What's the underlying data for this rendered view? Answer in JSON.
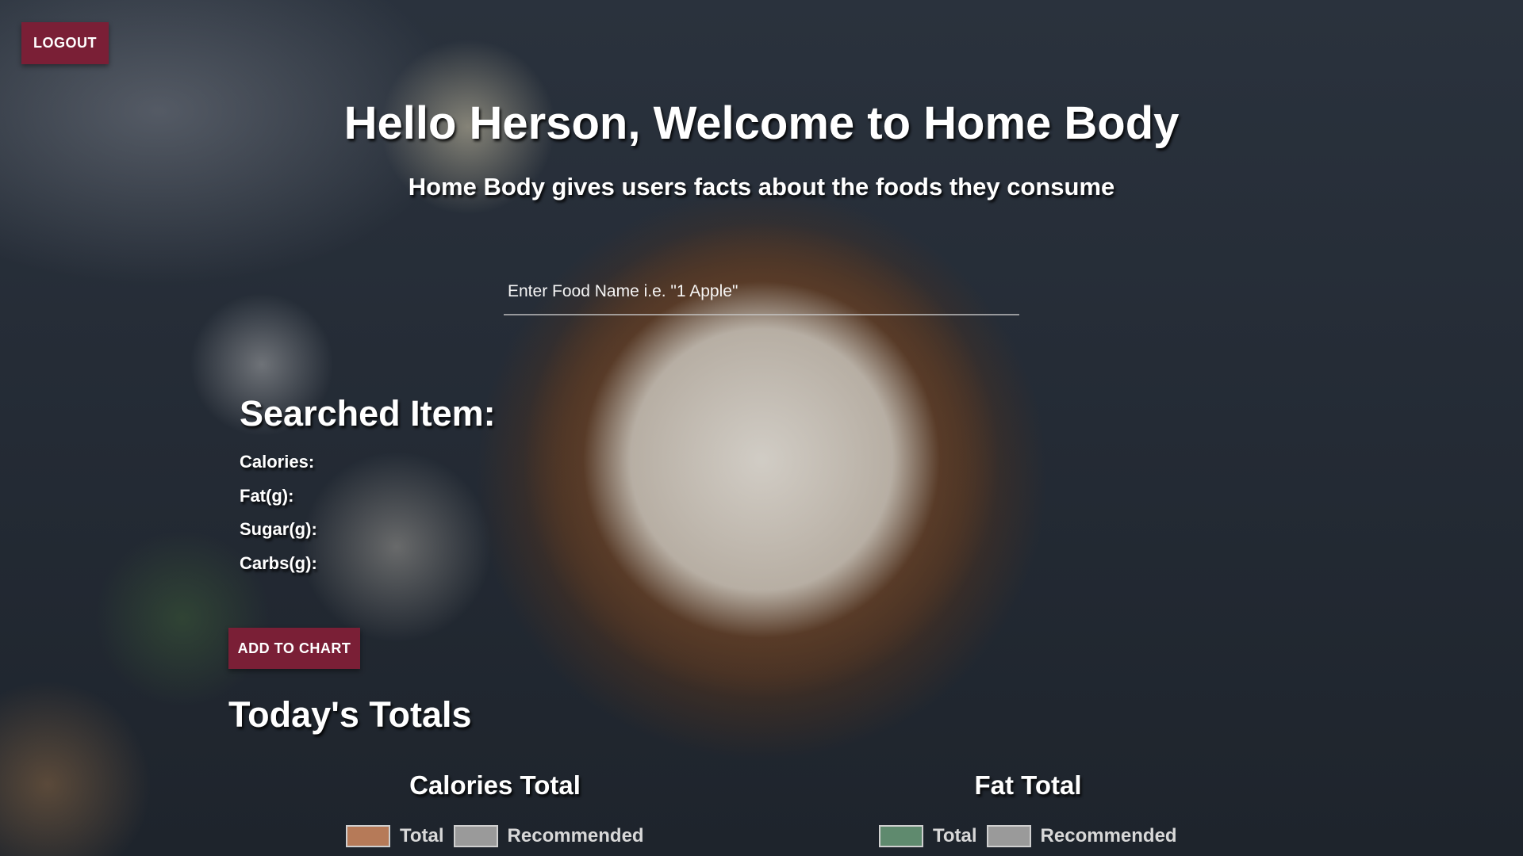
{
  "header": {
    "logout_label": "LOGOUT",
    "title": "Hello Herson, Welcome to Home Body",
    "subtitle": "Home Body gives users facts about the foods they consume"
  },
  "search": {
    "placeholder": "Enter Food Name i.e. \"1 Apple\"",
    "value": ""
  },
  "searched_item": {
    "title": "Searched Item:",
    "calories_label": "Calories:",
    "fat_label": "Fat(g):",
    "sugar_label": "Sugar(g):",
    "carbs_label": "Carbs(g):",
    "add_button_label": "ADD TO CHART"
  },
  "totals": {
    "title": "Today's Totals",
    "charts": [
      {
        "title": "Calories Total",
        "legend": [
          {
            "label": "Total",
            "color": "#b67a58"
          },
          {
            "label": "Recommended",
            "color": "#9a9a9a"
          }
        ]
      },
      {
        "title": "Fat Total",
        "legend": [
          {
            "label": "Total",
            "color": "#5f8a6e"
          },
          {
            "label": "Recommended",
            "color": "#9a9a9a"
          }
        ]
      }
    ]
  },
  "colors": {
    "accent": "#7a1f36"
  }
}
